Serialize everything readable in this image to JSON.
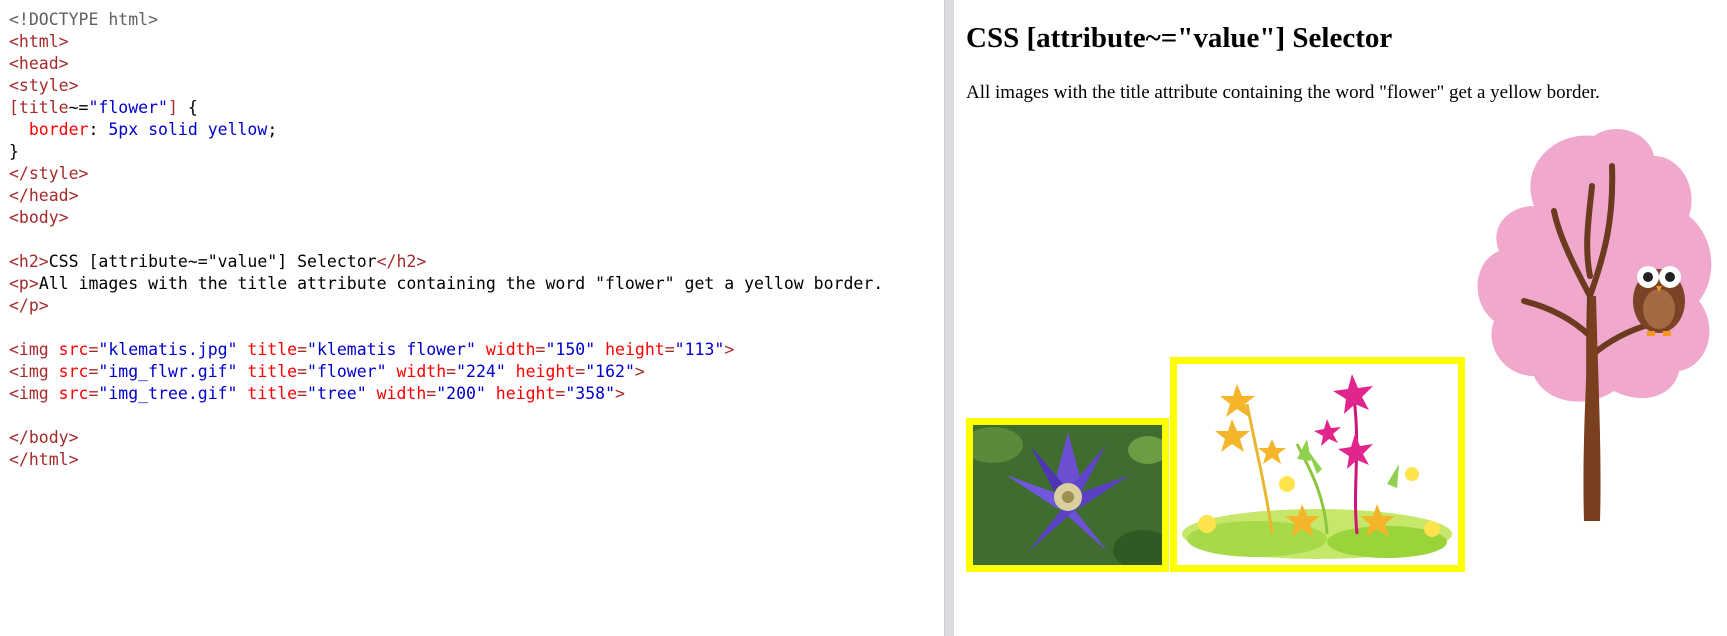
{
  "editor": {
    "lines": [
      [
        {
          "t": "dt",
          "v": "<!DOCTYPE html>"
        }
      ],
      [
        {
          "t": "tag",
          "v": "<html>"
        }
      ],
      [
        {
          "t": "tag",
          "v": "<head>"
        }
      ],
      [
        {
          "t": "tag",
          "v": "<style>"
        }
      ],
      [
        {
          "t": "sel",
          "v": "[title"
        },
        {
          "t": "txt",
          "v": "~="
        },
        {
          "t": "val",
          "v": "\"flower\""
        },
        {
          "t": "sel",
          "v": "]"
        },
        {
          "t": "txt",
          "v": " {"
        }
      ],
      [
        {
          "t": "txt",
          "v": "  "
        },
        {
          "t": "prop",
          "v": "border"
        },
        {
          "t": "txt",
          "v": ": "
        },
        {
          "t": "cssval",
          "v": "5px solid yellow"
        },
        {
          "t": "txt",
          "v": ";"
        }
      ],
      [
        {
          "t": "txt",
          "v": "}"
        }
      ],
      [
        {
          "t": "tag",
          "v": "</style>"
        }
      ],
      [
        {
          "t": "tag",
          "v": "</head>"
        }
      ],
      [
        {
          "t": "tag",
          "v": "<body>"
        }
      ],
      [
        {
          "t": "txt",
          "v": ""
        }
      ],
      [
        {
          "t": "tag",
          "v": "<h2>"
        },
        {
          "t": "txt",
          "v": "CSS [attribute~=\"value\"] Selector"
        },
        {
          "t": "tag",
          "v": "</h2>"
        }
      ],
      [
        {
          "t": "tag",
          "v": "<p>"
        },
        {
          "t": "txt",
          "v": "All images with the title attribute containing the word \"flower\" get a yellow border."
        }
      ],
      [
        {
          "t": "tag",
          "v": "</p>"
        }
      ],
      [
        {
          "t": "txt",
          "v": ""
        }
      ],
      [
        {
          "t": "tag",
          "v": "<img "
        },
        {
          "t": "attr",
          "v": "src"
        },
        {
          "t": "tag",
          "v": "="
        },
        {
          "t": "val",
          "v": "\"klematis.jpg\""
        },
        {
          "t": "attr",
          "v": " title"
        },
        {
          "t": "tag",
          "v": "="
        },
        {
          "t": "val",
          "v": "\"klematis flower\""
        },
        {
          "t": "attr",
          "v": " width"
        },
        {
          "t": "tag",
          "v": "="
        },
        {
          "t": "val",
          "v": "\"150\""
        },
        {
          "t": "attr",
          "v": " height"
        },
        {
          "t": "tag",
          "v": "="
        },
        {
          "t": "val",
          "v": "\"113\""
        },
        {
          "t": "tag",
          "v": ">"
        }
      ],
      [
        {
          "t": "tag",
          "v": "<img "
        },
        {
          "t": "attr",
          "v": "src"
        },
        {
          "t": "tag",
          "v": "="
        },
        {
          "t": "val",
          "v": "\"img_flwr.gif\""
        },
        {
          "t": "attr",
          "v": " title"
        },
        {
          "t": "tag",
          "v": "="
        },
        {
          "t": "val",
          "v": "\"flower\""
        },
        {
          "t": "attr",
          "v": " width"
        },
        {
          "t": "tag",
          "v": "="
        },
        {
          "t": "val",
          "v": "\"224\""
        },
        {
          "t": "attr",
          "v": " height"
        },
        {
          "t": "tag",
          "v": "="
        },
        {
          "t": "val",
          "v": "\"162\""
        },
        {
          "t": "tag",
          "v": ">"
        }
      ],
      [
        {
          "t": "tag",
          "v": "<img "
        },
        {
          "t": "attr",
          "v": "src"
        },
        {
          "t": "tag",
          "v": "="
        },
        {
          "t": "val",
          "v": "\"img_tree.gif\""
        },
        {
          "t": "attr",
          "v": " title"
        },
        {
          "t": "tag",
          "v": "="
        },
        {
          "t": "val",
          "v": "\"tree\""
        },
        {
          "t": "attr",
          "v": " width"
        },
        {
          "t": "tag",
          "v": "="
        },
        {
          "t": "val",
          "v": "\"200\""
        },
        {
          "t": "attr",
          "v": " height"
        },
        {
          "t": "tag",
          "v": "="
        },
        {
          "t": "val",
          "v": "\"358\""
        },
        {
          "t": "tag",
          "v": ">"
        }
      ],
      [
        {
          "t": "txt",
          "v": ""
        }
      ],
      [
        {
          "t": "tag",
          "v": "</body>"
        }
      ],
      [
        {
          "t": "tag",
          "v": "</html>"
        }
      ]
    ]
  },
  "result": {
    "heading": "CSS [attribute~=\"value\"] Selector",
    "paragraph": "All images with the title attribute containing the word \"flower\" get a yellow border.",
    "images": [
      {
        "name": "klematis-image",
        "icon": "klematis-flower-photo",
        "border_color": "#ffff00"
      },
      {
        "name": "flower-image",
        "icon": "flower-illustration",
        "border_color": "#ffff00"
      },
      {
        "name": "tree-image",
        "icon": "tree-with-owl-illustration"
      }
    ]
  },
  "colors": {
    "tag": "#a52a2a",
    "attr": "#ff0000",
    "val": "#0000cd",
    "border_highlight": "#ffff00",
    "divider": "#d9dbe0"
  }
}
